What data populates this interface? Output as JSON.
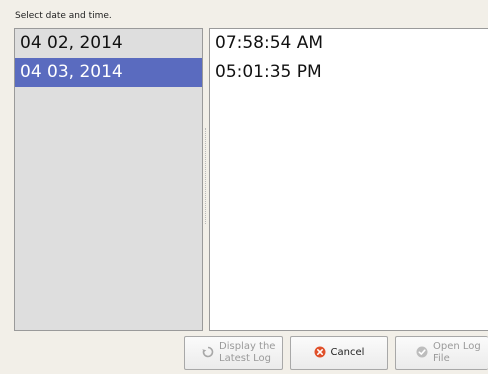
{
  "prompt": "Select date and time.",
  "dates": [
    {
      "label": "04 02, 2014",
      "selected": false
    },
    {
      "label": "04 03, 2014",
      "selected": true
    }
  ],
  "times": [
    "07:58:54 AM",
    "05:01:35 PM"
  ],
  "buttons": {
    "latest_log": {
      "label": "Display the\nLatest Log",
      "icon": "refresh-icon",
      "enabled": false
    },
    "cancel": {
      "label": "Cancel",
      "icon": "cancel-icon",
      "enabled": true
    },
    "open_log": {
      "label": "Open Log\nFile",
      "icon": "check-icon",
      "enabled": false
    }
  },
  "colors": {
    "selection": "#5a6bbf",
    "cancel_icon": "#e0502a"
  }
}
